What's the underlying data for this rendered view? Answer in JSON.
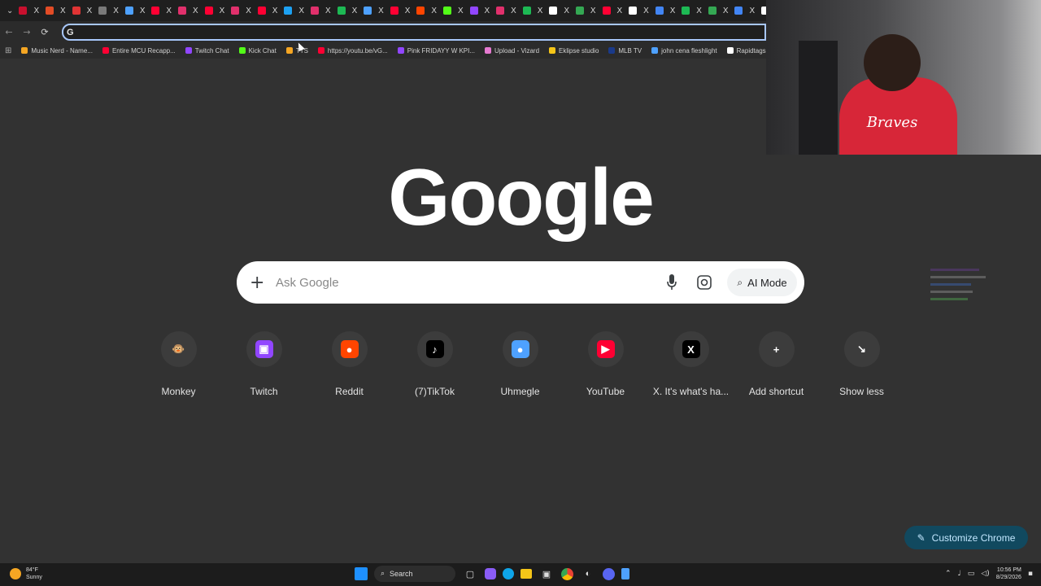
{
  "browser": {
    "omnibox": {
      "value": "",
      "placeholder": ""
    },
    "omnibox_icon": "G",
    "tab_close_glyph": "X",
    "tab_favicons": [
      "#c8102e",
      "#e34c26",
      "#e03434",
      "#7a7a7a",
      "#4ea1ff",
      "#ff0033",
      "#e1306c",
      "#ff0033",
      "#e1306c",
      "#ff0033",
      "#1da1f2",
      "#e1306c",
      "#1db954",
      "#4ea1ff",
      "#ff0033",
      "#ff4500",
      "#53fc18",
      "#9146ff",
      "#e1306c",
      "#1db954",
      "#ffffff",
      "#34a853",
      "#ff0033",
      "#ffffff",
      "#4285f4",
      "#1db954",
      "#34a853",
      "#4285f4",
      "#ffffff",
      "#ff0033"
    ],
    "bookmarks": [
      {
        "label": "Music Nerd - Name...",
        "color": "#f5a623"
      },
      {
        "label": "Entire MCU Recapp...",
        "color": "#ff0033"
      },
      {
        "label": "Twitch Chat",
        "color": "#9146ff"
      },
      {
        "label": "Kick Chat",
        "color": "#53fc18"
      },
      {
        "label": "TTS",
        "color": "#f5a623"
      },
      {
        "label": "https://youtu.be/vG...",
        "color": "#ff0033"
      },
      {
        "label": "Pink FRIDAYY W KPI...",
        "color": "#9146ff"
      },
      {
        "label": "Upload - Vizard",
        "color": "#e67ad1"
      },
      {
        "label": "Eklipse studio",
        "color": "#f5c518"
      },
      {
        "label": "MLB TV",
        "color": "#1a3a8a"
      },
      {
        "label": "john cena fleshlight",
        "color": "#4ea1ff"
      },
      {
        "label": "Rapidtags | YouTub...",
        "color": "#ffffff"
      }
    ]
  },
  "google": {
    "logo": "Google",
    "search_placeholder": "Ask Google",
    "ai_mode_label": "AI Mode",
    "shortcuts": [
      {
        "label": "Monkey",
        "icon": "monkey-icon",
        "glyph": "🐵",
        "color": "#3c3c3c"
      },
      {
        "label": "Twitch",
        "icon": "twitch-icon",
        "glyph": "▣",
        "color": "#9146ff"
      },
      {
        "label": "Reddit",
        "icon": "reddit-icon",
        "glyph": "●",
        "color": "#ff4500"
      },
      {
        "label": "(7)TikTok",
        "icon": "tiktok-icon",
        "glyph": "♪",
        "color": "#000000"
      },
      {
        "label": "Uhmegle",
        "icon": "chat-bubble-icon",
        "glyph": "●",
        "color": "#4ea1ff"
      },
      {
        "label": "YouTube",
        "icon": "youtube-icon",
        "glyph": "▶",
        "color": "#ff0033"
      },
      {
        "label": "X. It's what's ha...",
        "icon": "x-icon",
        "glyph": "X",
        "color": "#000000"
      },
      {
        "label": "Add shortcut",
        "icon": "plus-icon",
        "glyph": "+",
        "color": "#3c3c3c"
      },
      {
        "label": "Show less",
        "icon": "collapse-icon",
        "glyph": "↘",
        "color": "#3c3c3c"
      }
    ],
    "customize_label": "Customize Chrome"
  },
  "webcam": {
    "shirt_text": "Braves"
  },
  "taskbar": {
    "weather_temp": "84°F",
    "weather_desc": "Sunny",
    "search_label": "Search",
    "time": "10:56 PM",
    "date": "8/29/2026"
  }
}
